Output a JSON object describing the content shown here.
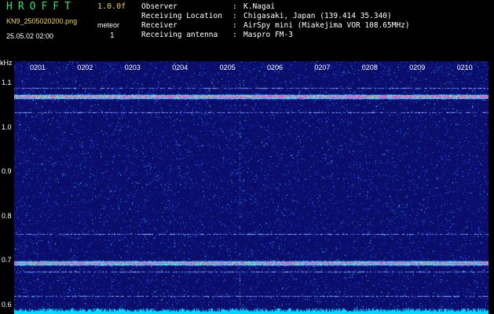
{
  "header": {
    "app_title": "HROFFT",
    "version": "1.0.0f",
    "file_name": "KN9_2505020200.png",
    "meteor_label": "meteor",
    "meteor_count": "1",
    "datetime": "25.05.02 02:00"
  },
  "info": [
    {
      "key": "Observer",
      "value": "K.Nagai"
    },
    {
      "key": "Receiving Location",
      "value": "Chigasaki, Japan (139.414 35.340)"
    },
    {
      "key": "Receiver",
      "value": "AirSpy mini (Miakejima VOR 108.65MHz)"
    },
    {
      "key": "Receiving antenna",
      "value": "Maspro FM-3"
    }
  ],
  "chart_data": {
    "type": "heatmap",
    "ylabel": "kHz",
    "ylim": [
      0.58,
      1.15
    ],
    "yticks": [
      "1.1",
      "1.0",
      "0.9",
      "0.8",
      "0.7",
      "0.6"
    ],
    "xticks": [
      "0201",
      "0202",
      "0203",
      "0204",
      "0205",
      "0206",
      "0207",
      "0208",
      "0209",
      "0210"
    ],
    "strong_lines_khz": [
      1.07,
      0.695
    ],
    "weak_lines_khz": [
      1.09,
      1.035,
      0.76,
      0.675,
      0.62
    ],
    "meteor_time": "0205",
    "colors": {
      "background": "#0a0d6a",
      "signal_high": "#ff3ad0",
      "signal_mid": "#33ffd8",
      "noise_floor": "#00d8ff"
    }
  }
}
